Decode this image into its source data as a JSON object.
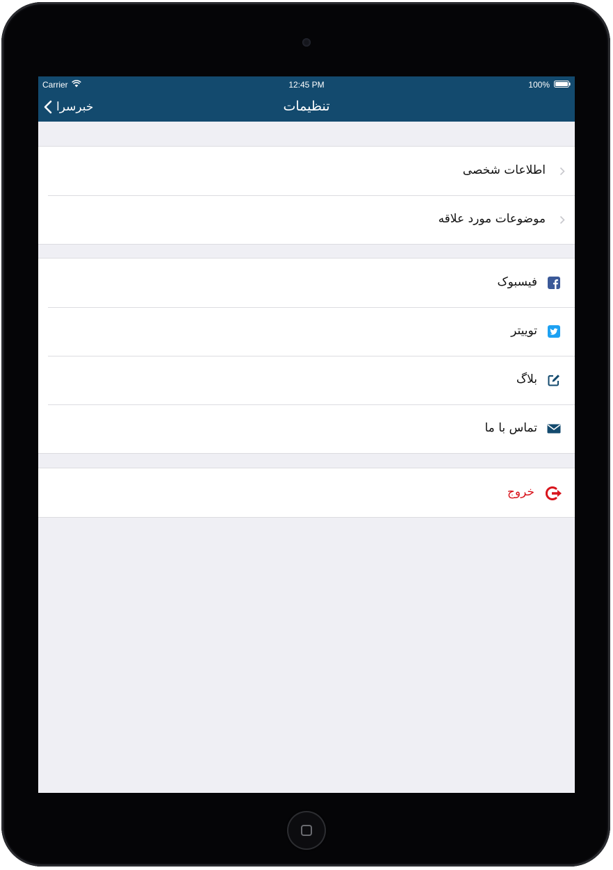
{
  "status_bar": {
    "carrier": "Carrier",
    "time": "12:45 PM",
    "battery": "100%"
  },
  "nav": {
    "title": "تنظیمات",
    "back_label": "خبرسرا"
  },
  "groups": {
    "account": [
      {
        "label": "اطلاعات شخصی"
      },
      {
        "label": "موضوعات مورد علاقه"
      }
    ],
    "social": [
      {
        "label": "فیسبوک",
        "icon": "facebook-icon"
      },
      {
        "label": "توییتر",
        "icon": "twitter-icon"
      },
      {
        "label": "بلاگ",
        "icon": "edit-icon"
      },
      {
        "label": "تماس با ما",
        "icon": "envelope-icon"
      }
    ],
    "session": [
      {
        "label": "خروج",
        "icon": "logout-icon"
      }
    ]
  },
  "colors": {
    "nav_bar": "#134a6e",
    "background": "#efeff4",
    "logout": "#d8141c",
    "facebook": "#3b5998",
    "twitter": "#1da1f2",
    "icon_dark": "#134a6e"
  }
}
